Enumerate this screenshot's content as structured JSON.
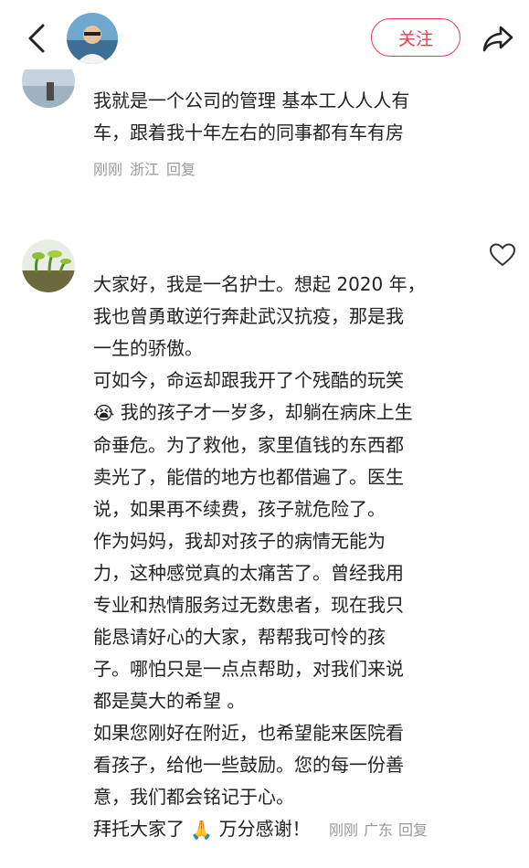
{
  "header": {
    "follow_label": "关注"
  },
  "comments": [
    {
      "lines": [
        "我就是一个公司的管理  基本工人人人有",
        "车，跟着我十年左右的同事都有车有房"
      ],
      "time": "刚刚",
      "location": "浙江",
      "reply_label": "回复"
    },
    {
      "lines": [
        "大家好，我是一名护士。想起 2020 年，",
        "我也曾勇敢逆行奔赴武汉抗疫，那是我",
        "一生的骄傲。",
        "可如今，命运却跟我开了个残酷的玩笑",
        "我的孩子才一岁多，却躺在病床上生",
        "命垂危。为了救他，家里值钱的东西都",
        "卖光了，能借的地方也都借遍了。医生",
        "说，如果再不续费，孩子就危险了。",
        "作为妈妈，我却对孩子的病情无能为",
        "力，这种感觉真的太痛苦了。曾经我用",
        "专业和热情服务过无数患者，现在我只",
        "能恳请好心的大家，帮帮我可怜的孩",
        "子。哪怕只是一点点帮助，对我们来说",
        "都是莫大的希望 。",
        "如果您刚好在附近，也希望能来医院看",
        "看孩子，给他一些鼓励。您的每一份善",
        "意，我们都会铭记于心。",
        "拜托大家了",
        "万分感谢！"
      ],
      "emoji_crying": "😭",
      "emoji_pray": "🙏",
      "time": "刚刚",
      "location": "广东",
      "reply_label": "回复"
    }
  ],
  "colors": {
    "accent": "#ee3b4f",
    "meta_gray": "#999999"
  },
  "icons": [
    "back-arrow-icon",
    "share-icon",
    "heart-outline-icon"
  ]
}
